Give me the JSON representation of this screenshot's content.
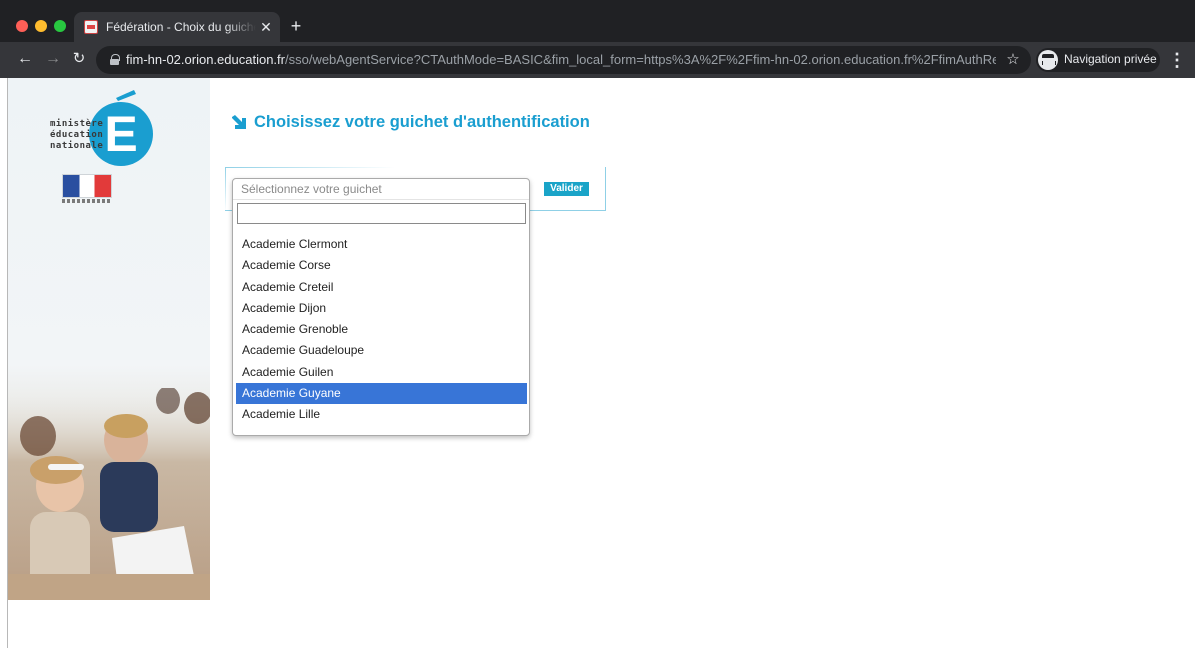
{
  "browser": {
    "tab_title": "Fédération - Choix du guichet d'authentification",
    "url_host": "fim-hn-02.orion.education.fr",
    "url_path": "/sso/webAgentService?CTAuthMode=BASIC&fim_local_form=https%3A%2F%2Ffim-hn-02.orion.education.fr%2FfimAuthReq...",
    "incognito_label": "Navigation privée"
  },
  "logo": {
    "lines": [
      "ministère",
      "éducation",
      "nationale"
    ]
  },
  "page": {
    "heading": "Choisissez votre guichet d'authentification",
    "submit_label": "Valider",
    "accent_color": "#1a9ed0"
  },
  "dropdown": {
    "placeholder": "Sélectionnez votre guichet",
    "search_value": "",
    "options": [
      "Academie Clermont",
      "Academie Corse",
      "Academie Creteil",
      "Academie Dijon",
      "Academie Grenoble",
      "Academie Guadeloupe",
      "Academie Guilen",
      "Academie Guyane",
      "Academie Lille"
    ],
    "selected_option": "Academie Guyane",
    "highlight_color": "#3875d7"
  }
}
